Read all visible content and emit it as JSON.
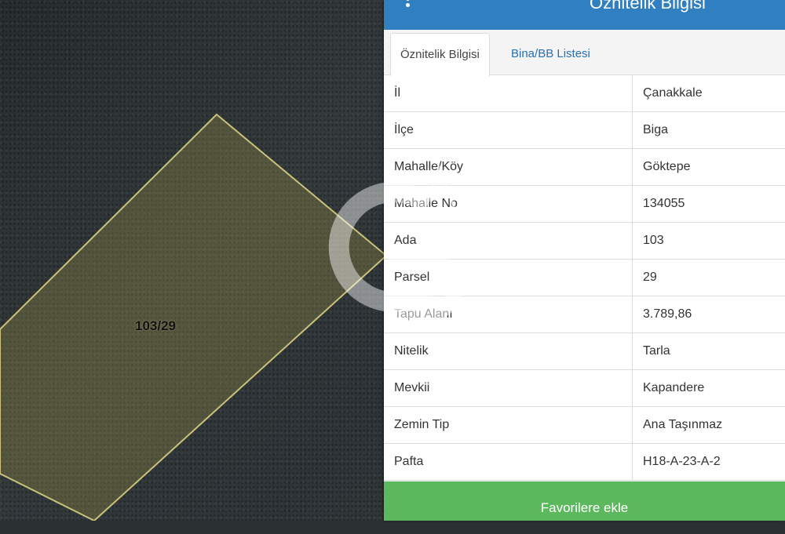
{
  "panel": {
    "title": "Öznitelik Bilgisi",
    "tabs": [
      {
        "label": "Öznitelik Bilgisi",
        "active": true
      },
      {
        "label": "Bina/BB Listesi",
        "active": false
      }
    ],
    "rows": [
      {
        "key": "İl",
        "value": "Çanakkale"
      },
      {
        "key": "İlçe",
        "value": "Biga"
      },
      {
        "key": "Mahalle/Köy",
        "value": "Göktepe"
      },
      {
        "key": "Mahalle No",
        "value": "134055"
      },
      {
        "key": "Ada",
        "value": "103"
      },
      {
        "key": "Parsel",
        "value": "29"
      },
      {
        "key": "Tapu Alanı",
        "value": "3.789,86"
      },
      {
        "key": "Nitelik",
        "value": "Tarla"
      },
      {
        "key": "Mevkii",
        "value": "Kapandere"
      },
      {
        "key": "Zemin Tip",
        "value": "Ana Taşınmaz"
      },
      {
        "key": "Pafta",
        "value": "H18-A-23-A-2"
      }
    ],
    "favorite_button": "Favorilere ekle"
  },
  "map": {
    "parcel_label": "103/29",
    "parcel_color": "#c9c27a"
  },
  "colors": {
    "header": "#2f7fc1",
    "button": "#5cb85c",
    "tab_link": "#2a6fb4"
  },
  "icons": [
    "menu-icon",
    "watermark-logo"
  ]
}
